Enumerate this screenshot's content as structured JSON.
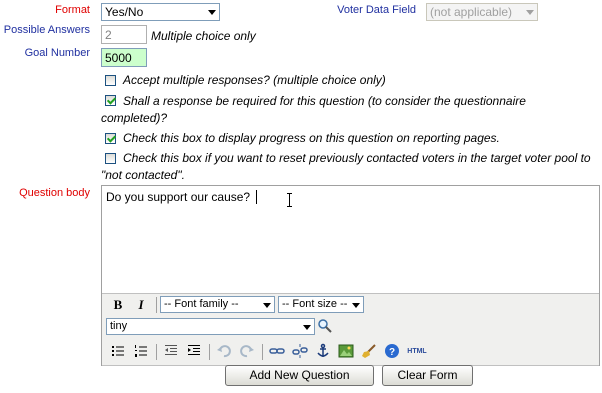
{
  "form": {
    "format": {
      "label": "Format",
      "value": "Yes/No"
    },
    "voter_data_field": {
      "label": "Voter Data Field",
      "value": "(not applicable)"
    },
    "possible_answers": {
      "label": "Possible Answers",
      "value": "2",
      "note": "Multiple choice only"
    },
    "goal_number": {
      "label": "Goal Number",
      "value": "5000"
    },
    "options": [
      {
        "label": "Accept multiple responses? (multiple choice only)",
        "checked": false
      },
      {
        "label_line1": "Shall a response be required for this question (to consider the questionnaire",
        "label_line2": "completed)?",
        "checked": true
      },
      {
        "label": "Check this box to display progress on this question on reporting pages.",
        "checked": true
      },
      {
        "label_line1": "Check this box if you want to reset previously contacted voters in the target voter pool to",
        "label_line2": "\"not contacted\".",
        "checked": false
      }
    ],
    "question_body": {
      "label": "Question body",
      "value": "Do you support our cause?"
    }
  },
  "editor": {
    "bold_label": "B",
    "italic_label": "I",
    "font_family": "-- Font family --",
    "font_size": "-- Font size --",
    "style_value": "tiny",
    "html_label": "HTML"
  },
  "buttons": {
    "add": "Add New Question",
    "clear": "Clear Form"
  },
  "colors": {
    "label_red": "#e00000",
    "label_blue": "#2030a0",
    "goal_field_bg": "#ccffcc"
  }
}
